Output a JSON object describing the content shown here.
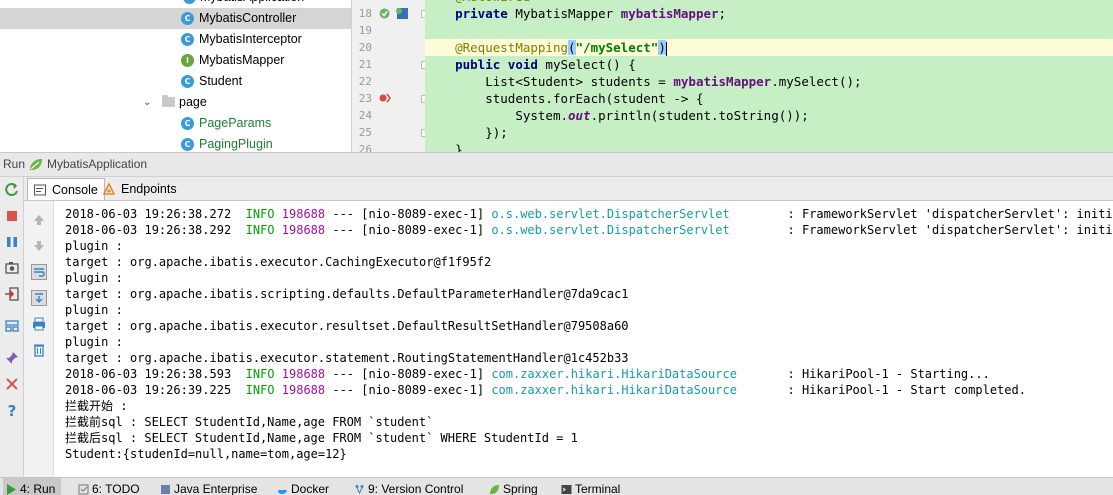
{
  "project_tree": {
    "partial_top_item": "MybatisApplication",
    "items": [
      {
        "label": "MybatisController",
        "kind": "c",
        "selected": true
      },
      {
        "label": "MybatisInterceptor",
        "kind": "c"
      },
      {
        "label": "MybatisMapper",
        "kind": "i"
      },
      {
        "label": "Student",
        "kind": "c"
      }
    ],
    "package": {
      "label": "page"
    },
    "package_items": [
      {
        "label": "PageParams",
        "kind": "c"
      },
      {
        "label": "PagingPlugin",
        "kind": "c"
      }
    ]
  },
  "editor": {
    "line_numbers": [
      "18",
      "19",
      "20",
      "21",
      "22",
      "23",
      "24",
      "25",
      "26"
    ],
    "lines": {
      "l18_kw": "private",
      "l18_type": " MybatisMapper ",
      "l18_field": "mybatisMapper",
      "l18_end": ";",
      "l20_ann": "@RequestMapping",
      "l20_open": "(",
      "l20_str": "\"/mySelect\"",
      "l20_close": ")",
      "l21_kw1": "public",
      "l21_kw2": "void",
      "l21_rest": " mySelect() {",
      "l22_a": "List<Student> students = ",
      "l22_field": "mybatisMapper",
      "l22_b": ".mySelect();",
      "l23": "students.forEach(student -> {",
      "l24_a": "System.",
      "l24_static": "out",
      "l24_b": ".println(student.toString());",
      "l25": "});",
      "l26": "}"
    }
  },
  "run_bar": {
    "label": "Run",
    "config": "MybatisApplication"
  },
  "console_tabs": [
    {
      "label": "Console",
      "active": true
    },
    {
      "label": "Endpoints",
      "active": false
    }
  ],
  "console": {
    "lines": [
      {
        "type": "log",
        "ts": "2018-06-03 19:26:38.272",
        "level": "INFO",
        "pid": "198688",
        "sep": " --- ",
        "thread": "[nio-8089-exec-1]",
        "logger": "o.s.web.servlet.DispatcherServlet",
        "msg": ": FrameworkServlet 'dispatcherServlet': initializa"
      },
      {
        "type": "log",
        "ts": "2018-06-03 19:26:38.292",
        "level": "INFO",
        "pid": "198688",
        "sep": " --- ",
        "thread": "[nio-8089-exec-1]",
        "logger": "o.s.web.servlet.DispatcherServlet",
        "msg": ": FrameworkServlet 'dispatcherServlet': initializa"
      },
      {
        "type": "text",
        "text": "plugin :"
      },
      {
        "type": "text",
        "text": "target : org.apache.ibatis.executor.CachingExecutor@f1f95f2"
      },
      {
        "type": "text",
        "text": "plugin :"
      },
      {
        "type": "text",
        "text": "target : org.apache.ibatis.scripting.defaults.DefaultParameterHandler@7da9cac1"
      },
      {
        "type": "text",
        "text": "plugin :"
      },
      {
        "type": "text",
        "text": "target : org.apache.ibatis.executor.resultset.DefaultResultSetHandler@79508a60"
      },
      {
        "type": "text",
        "text": "plugin :"
      },
      {
        "type": "text",
        "text": "target : org.apache.ibatis.executor.statement.RoutingStatementHandler@1c452b33"
      },
      {
        "type": "log",
        "ts": "2018-06-03 19:26:38.593",
        "level": "INFO",
        "pid": "198688",
        "sep": " --- ",
        "thread": "[nio-8089-exec-1]",
        "logger": "com.zaxxer.hikari.HikariDataSource",
        "msg": ": HikariPool-1 - Starting..."
      },
      {
        "type": "log",
        "ts": "2018-06-03 19:26:39.225",
        "level": "INFO",
        "pid": "198688",
        "sep": " --- ",
        "thread": "[nio-8089-exec-1]",
        "logger": "com.zaxxer.hikari.HikariDataSource",
        "msg": ": HikariPool-1 - Start completed."
      },
      {
        "type": "text",
        "text": "拦截开始 :"
      },
      {
        "type": "text",
        "text": "拦截前sql : SELECT StudentId,Name,age FROM `student`"
      },
      {
        "type": "text",
        "text": "拦截后sql : SELECT StudentId,Name,age FROM `student` WHERE StudentId = 1"
      },
      {
        "type": "text",
        "text": "Student:{studenId=null,name=tom,age=12}"
      }
    ]
  },
  "bottom_bar": {
    "items": [
      {
        "label": "4: Run",
        "active": true
      },
      {
        "label": "6: TODO"
      },
      {
        "label": "Java Enterprise"
      },
      {
        "label": "Docker"
      },
      {
        "label": "9: Version Control"
      },
      {
        "label": "Spring"
      },
      {
        "label": "Terminal"
      }
    ]
  },
  "colors": {
    "editor_bg": "#c6efc6",
    "current_line": "#fdfbd8",
    "info": "#00a000",
    "pid": "#a010a0",
    "logger": "#1a9aa6"
  }
}
